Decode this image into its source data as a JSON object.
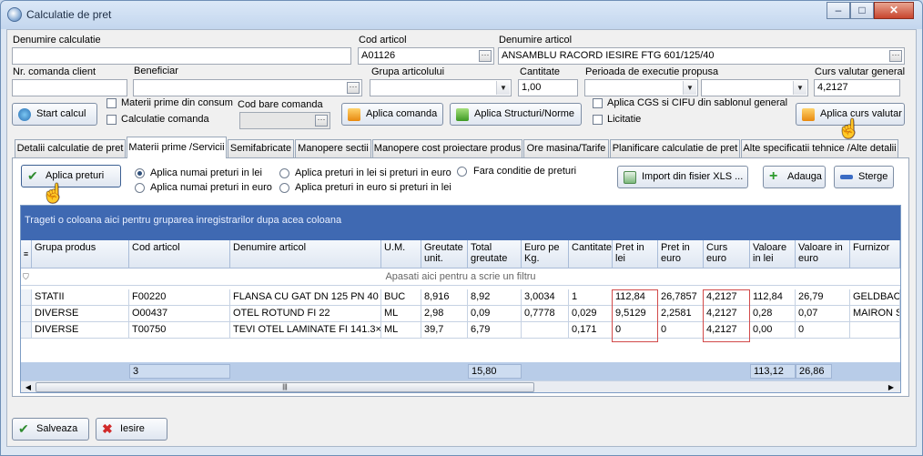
{
  "window": {
    "title": "Calculatie de pret",
    "controls": [
      "–",
      "□",
      "✕"
    ]
  },
  "header": {
    "denumire_calculatie": {
      "label": "Denumire calculatie",
      "value": ""
    },
    "cod_articol": {
      "label": "Cod articol",
      "value": "A01126"
    },
    "denumire_articol": {
      "label": "Denumire articol",
      "value": "ANSAMBLU RACORD IESIRE FTG 601/125/40"
    },
    "nr_comanda": {
      "label": "Nr. comanda client",
      "value": ""
    },
    "beneficiar": {
      "label": "Beneficiar",
      "value": ""
    },
    "grupa_articolului": {
      "label": "Grupa articolului",
      "value": ""
    },
    "cantitate": {
      "label": "Cantitate",
      "value": "1,00"
    },
    "perioada": {
      "label": "Perioada de executie propusa",
      "value": ""
    },
    "curs_valutar": {
      "label": "Curs valutar general",
      "value": "4,2127"
    },
    "cod_bare": {
      "label": "Cod bare comanda",
      "value": ""
    },
    "start_calcul": "Start calcul",
    "materii_prime_consum": "Materii prime din consum",
    "calculatie_comanda": "Calculatie comanda",
    "aplica_comanda": "Aplica comanda",
    "aplica_structuri": "Aplica Structuri/Norme",
    "aplica_cgs": "Aplica CGS si CIFU din sablonul general",
    "licitatie": "Licitatie",
    "aplica_curs": "Aplica curs valutar"
  },
  "tabs": [
    "Detalii calculatie de pret",
    "Materii prime /Servicii",
    "Semifabricate",
    "Manopere sectii",
    "Manopere cost proiectare produs",
    "Ore masina/Tarife",
    "Planificare calculatie de pret",
    "Alte specificatii tehnice /Alte detalii"
  ],
  "toolbar": {
    "aplica_preturi": "Aplica preturi",
    "radios": [
      "Aplica numai preturi in lei",
      "Aplica numai preturi in euro",
      "Aplica preturi in lei si preturi in euro",
      "Aplica preturi in euro si preturi in lei",
      "Fara conditie de preturi"
    ],
    "import_xls": "Import din fisier XLS ...",
    "adauga": "Adauga",
    "sterge": "Sterge"
  },
  "grid": {
    "group_text": "Trageti o coloana aici pentru gruparea inregistrarilor dupa acea coloana",
    "filter_text": "Apasati aici pentru a scrie un filtru",
    "columns": [
      "Grupa produs",
      "Cod articol",
      "Denumire articol",
      "U.M.",
      "Greutate unit.",
      "Total greutate",
      "Euro pe Kg.",
      "Cantitate",
      "Pret in lei",
      "Pret in euro",
      "Curs euro",
      "Valoare in lei",
      "Valoare in euro",
      "Furnizor"
    ],
    "rows": [
      [
        "STATII",
        "F00220",
        "FLANSA CU GAT DN 125 PN 40",
        "BUC",
        "8,916",
        "8,92",
        "3,0034",
        "1",
        "112,84",
        "26,7857",
        "4,2127",
        "112,84",
        "26,79",
        "GELDBACH"
      ],
      [
        "DIVERSE",
        "O00437",
        "OTEL ROTUND FI 22",
        "ML",
        "2,98",
        "0,09",
        "0,7778",
        "0,029",
        "9,5129",
        "2,2581",
        "4,2127",
        "0,28",
        "0,07",
        "MAIRON SA"
      ],
      [
        "DIVERSE",
        "T00750",
        "TEVI OTEL LAMINATE FI 141.3×",
        "ML",
        "39,7",
        "6,79",
        "",
        "0,171",
        "0",
        "0",
        "4,2127",
        "0,00",
        "0",
        ""
      ]
    ],
    "footer": {
      "count": "3",
      "total_greutate": "15,80",
      "valoare_lei": "113,12",
      "valoare_euro": "26,86"
    }
  },
  "bottom": {
    "salveaza": "Salveaza",
    "iesire": "Iesire"
  }
}
